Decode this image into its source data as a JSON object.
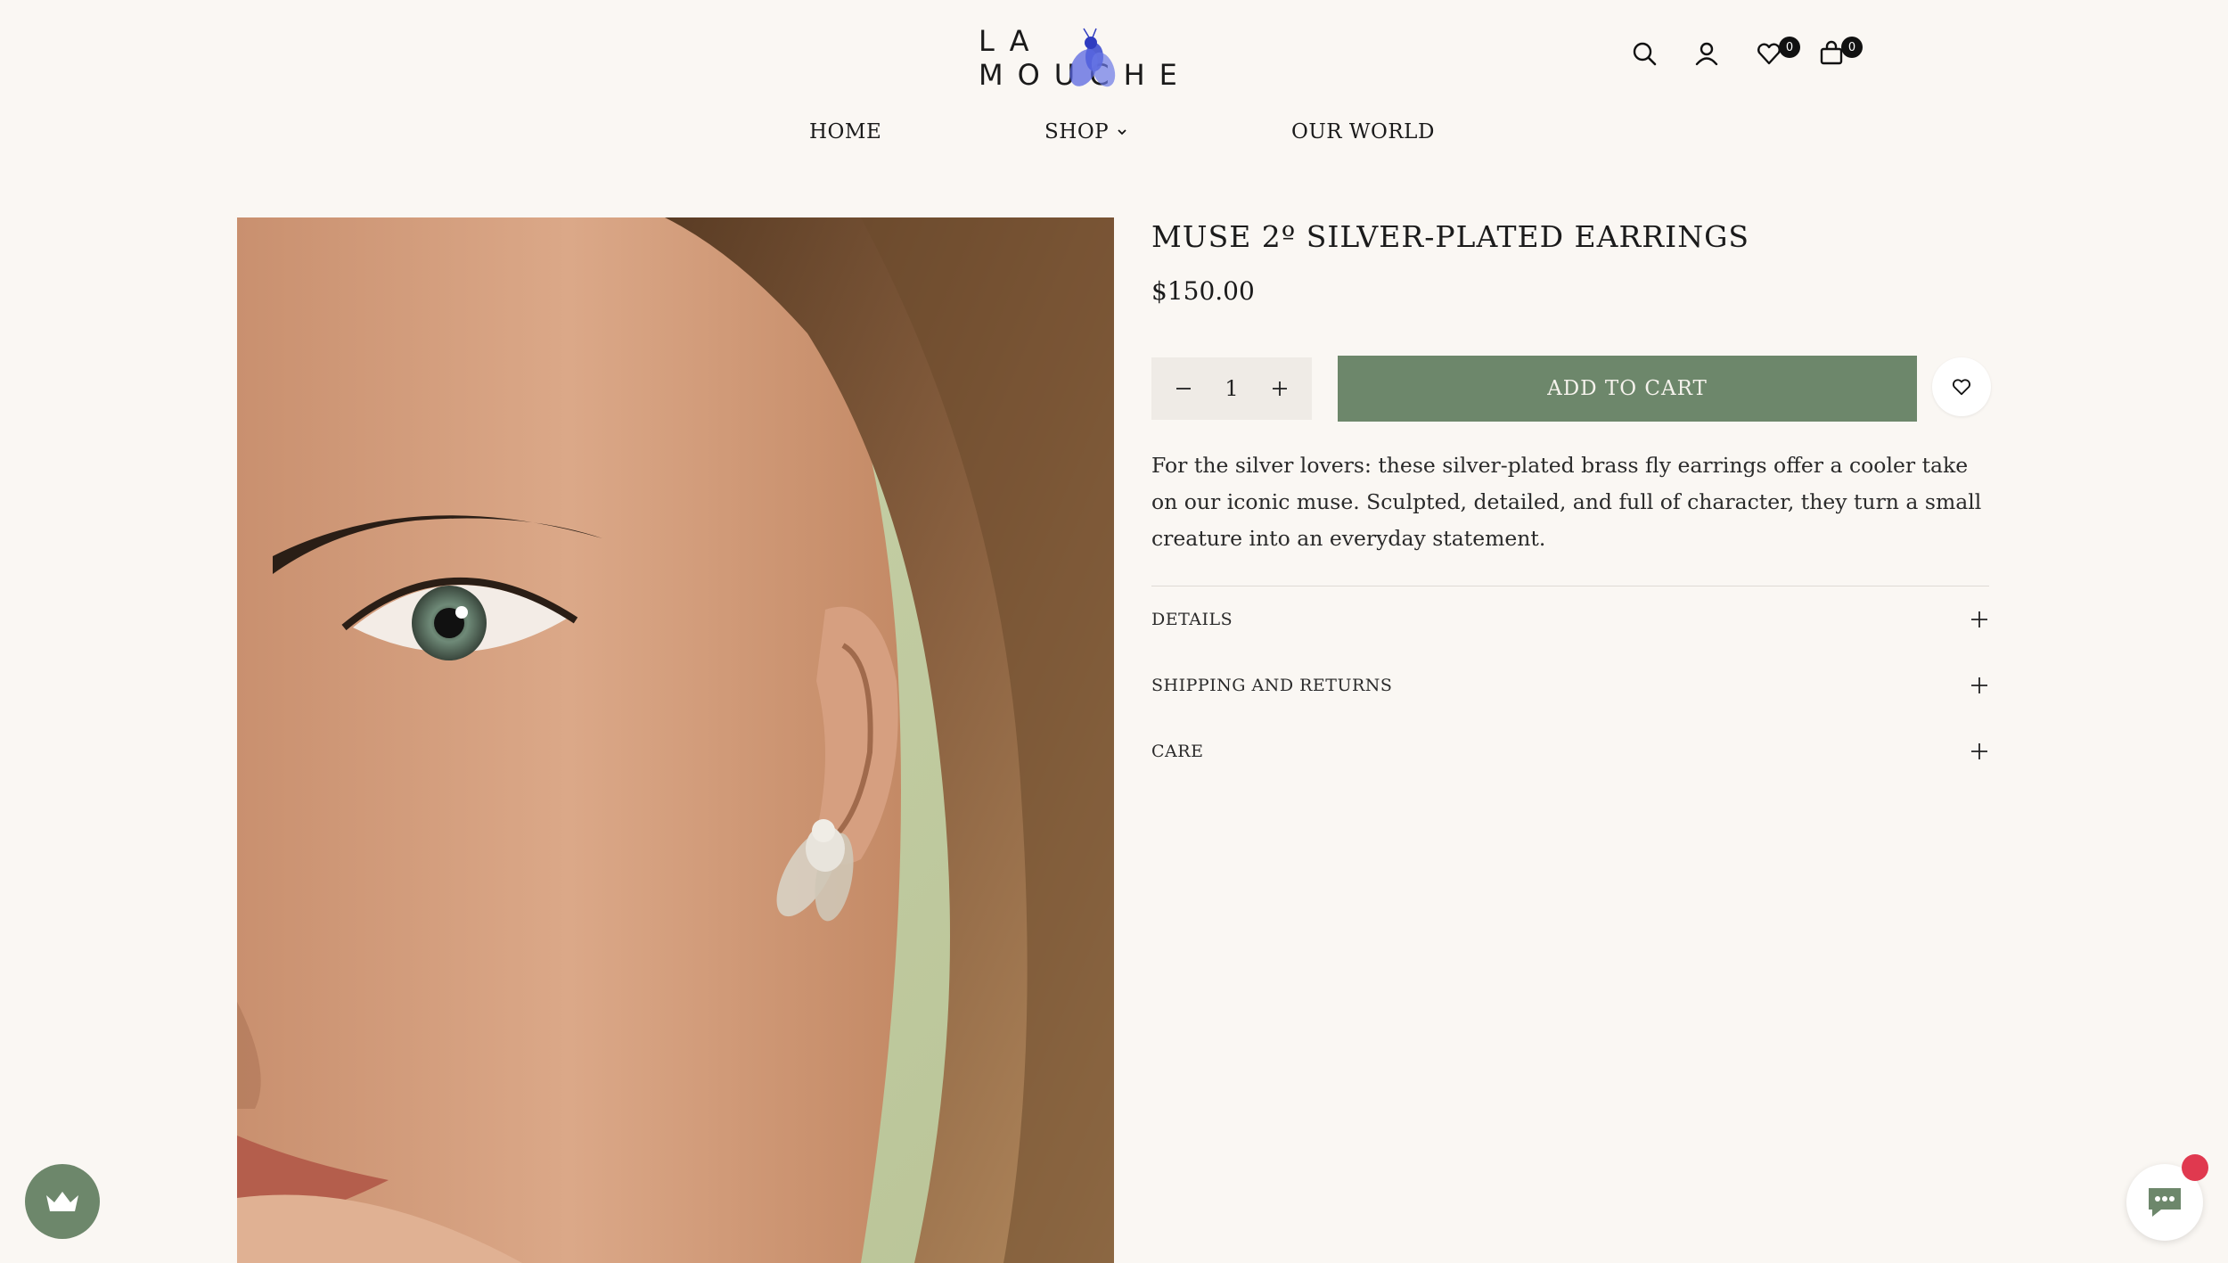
{
  "brand": {
    "logo_text": "LA MOUCHE",
    "logo_icon": "fly-icon",
    "accent_color": "#4a57d6"
  },
  "header": {
    "icons": [
      "search-icon",
      "account-icon",
      "wishlist-icon",
      "cart-icon"
    ],
    "wishlist_count": "0",
    "cart_count": "0"
  },
  "nav": {
    "items": [
      {
        "label": "HOME"
      },
      {
        "label": "SHOP"
      },
      {
        "label": "OUR WORLD"
      }
    ]
  },
  "product": {
    "title": "MUSE 2º SILVER-PLATED EARRINGS",
    "price": "$150.00",
    "quantity": "1",
    "add_to_cart_label": "ADD TO CART",
    "description": "For the silver lovers: these silver-plated brass fly earrings offer a cooler take on our iconic muse. Sculpted, detailed, and full of character, they turn a small creature into an everyday statement.",
    "accordion": [
      {
        "label": "DETAILS"
      },
      {
        "label": "SHIPPING AND RETURNS"
      },
      {
        "label": "CARE"
      }
    ]
  },
  "colors": {
    "background": "#faf7f3",
    "button_green": "#6d876b",
    "chat_dot": "#e0394f"
  }
}
